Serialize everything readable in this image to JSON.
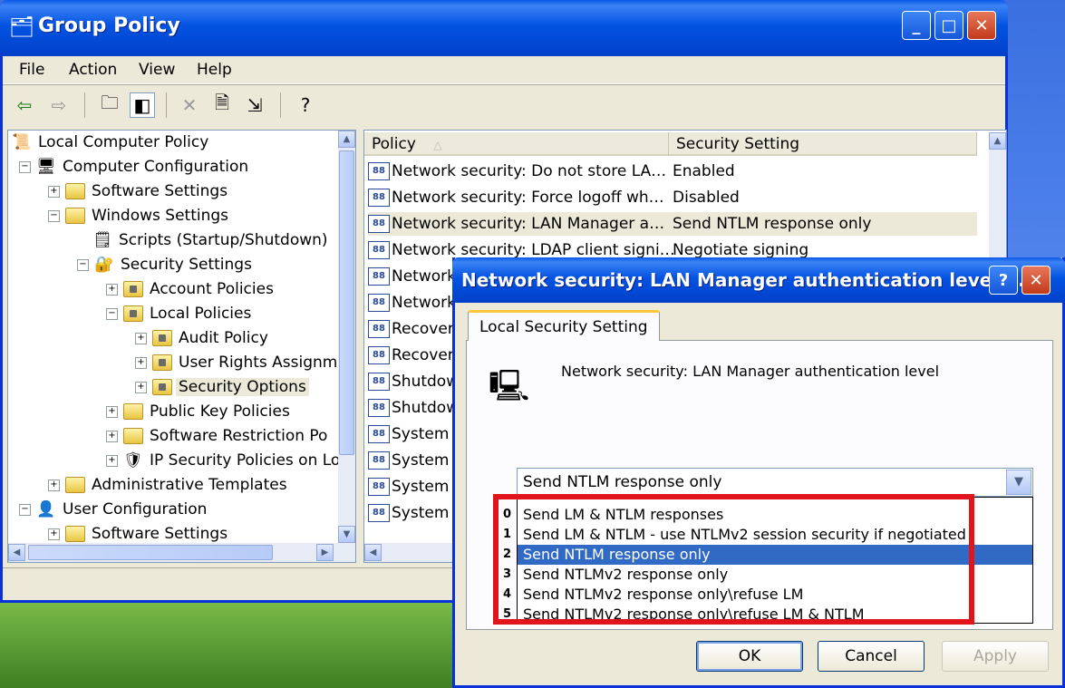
{
  "window": {
    "title": "Group Policy",
    "controls": {
      "minimize": "_",
      "maximize": "□",
      "close": "✕"
    }
  },
  "menu": [
    "File",
    "Action",
    "View",
    "Help"
  ],
  "toolbar": {
    "icons": [
      "back-arrow-icon",
      "forward-arrow-icon",
      "up-folder-icon",
      "show-hide-tree-icon",
      "delete-icon",
      "properties-icon",
      "export-list-icon",
      "help-icon"
    ]
  },
  "tree": {
    "items": [
      {
        "label": "Local Computer Policy",
        "icon": "policy-scroll-icon",
        "level": 0,
        "expander": ""
      },
      {
        "label": "Computer Configuration",
        "icon": "computer-icon",
        "level": 1,
        "expander": "−"
      },
      {
        "label": "Software Settings",
        "icon": "folder-icon",
        "level": 2,
        "expander": "+"
      },
      {
        "label": "Windows Settings",
        "icon": "folder-icon",
        "level": 2,
        "expander": "−"
      },
      {
        "label": "Scripts (Startup/Shutdown)",
        "icon": "script-icon",
        "level": 3,
        "expander": ""
      },
      {
        "label": "Security Settings",
        "icon": "security-icon",
        "level": 3,
        "expander": "−"
      },
      {
        "label": "Account Policies",
        "icon": "lock-folder-icon",
        "level": 4,
        "expander": "+"
      },
      {
        "label": "Local Policies",
        "icon": "lock-folder-icon",
        "level": 4,
        "expander": "−"
      },
      {
        "label": "Audit Policy",
        "icon": "lock-folder-icon",
        "level": 5,
        "expander": "+"
      },
      {
        "label": "User Rights Assignm",
        "icon": "lock-folder-icon",
        "level": 5,
        "expander": "+"
      },
      {
        "label": "Security Options",
        "icon": "lock-folder-icon",
        "level": 5,
        "expander": "+",
        "selected": true
      },
      {
        "label": "Public Key Policies",
        "icon": "folder-icon",
        "level": 4,
        "expander": "+"
      },
      {
        "label": "Software Restriction Po",
        "icon": "folder-icon",
        "level": 4,
        "expander": "+"
      },
      {
        "label": "IP Security Policies on Lo",
        "icon": "ip-security-icon",
        "level": 4,
        "expander": "+"
      },
      {
        "label": "Administrative Templates",
        "icon": "folder-icon",
        "level": 2,
        "expander": "+"
      },
      {
        "label": "User Configuration",
        "icon": "user-icon",
        "level": 1,
        "expander": "−"
      },
      {
        "label": "Software Settings",
        "icon": "folder-icon",
        "level": 2,
        "expander": "+"
      }
    ]
  },
  "list": {
    "columns": [
      "Policy",
      "Security Setting"
    ],
    "rows": [
      {
        "policy": "Network security: Do not store LA…",
        "setting": "Enabled"
      },
      {
        "policy": "Network security: Force logoff wh…",
        "setting": "Disabled"
      },
      {
        "policy": "Network security: LAN Manager a…",
        "setting": "Send NTLM response only",
        "highlight": true
      },
      {
        "policy": "Network security: LDAP client signi…",
        "setting": "Negotiate signing"
      },
      {
        "policy": "Network",
        "setting": ""
      },
      {
        "policy": "Network",
        "setting": ""
      },
      {
        "policy": "Recover",
        "setting": ""
      },
      {
        "policy": "Recover",
        "setting": ""
      },
      {
        "policy": "Shutdow",
        "setting": ""
      },
      {
        "policy": "Shutdow",
        "setting": ""
      },
      {
        "policy": "System",
        "setting": ""
      },
      {
        "policy": "System",
        "setting": ""
      },
      {
        "policy": "System",
        "setting": ""
      },
      {
        "policy": "System",
        "setting": ""
      }
    ]
  },
  "dialog": {
    "title": "Network security: LAN Manager authentication level ...",
    "help": "?",
    "close": "✕",
    "tab": "Local Security Setting",
    "policy_name": "Network security: LAN Manager authentication level",
    "selected_value": "Send NTLM response only",
    "options": [
      {
        "num": "0",
        "label": "Send LM & NTLM responses"
      },
      {
        "num": "1",
        "label": "Send LM & NTLM - use NTLMv2 session security if negotiated"
      },
      {
        "num": "2",
        "label": "Send NTLM response only",
        "selected": true
      },
      {
        "num": "3",
        "label": "Send NTLMv2 response only"
      },
      {
        "num": "4",
        "label": "Send NTLMv2 response only\\refuse LM"
      },
      {
        "num": "5",
        "label": "Send NTLMv2 response only\\refuse LM & NTLM"
      }
    ],
    "buttons": {
      "ok": "OK",
      "cancel": "Cancel",
      "apply": "Apply"
    }
  },
  "colors": {
    "titlebar": "#0453e3",
    "selection": "#316ac5",
    "highlight_box": "#e2141b"
  }
}
